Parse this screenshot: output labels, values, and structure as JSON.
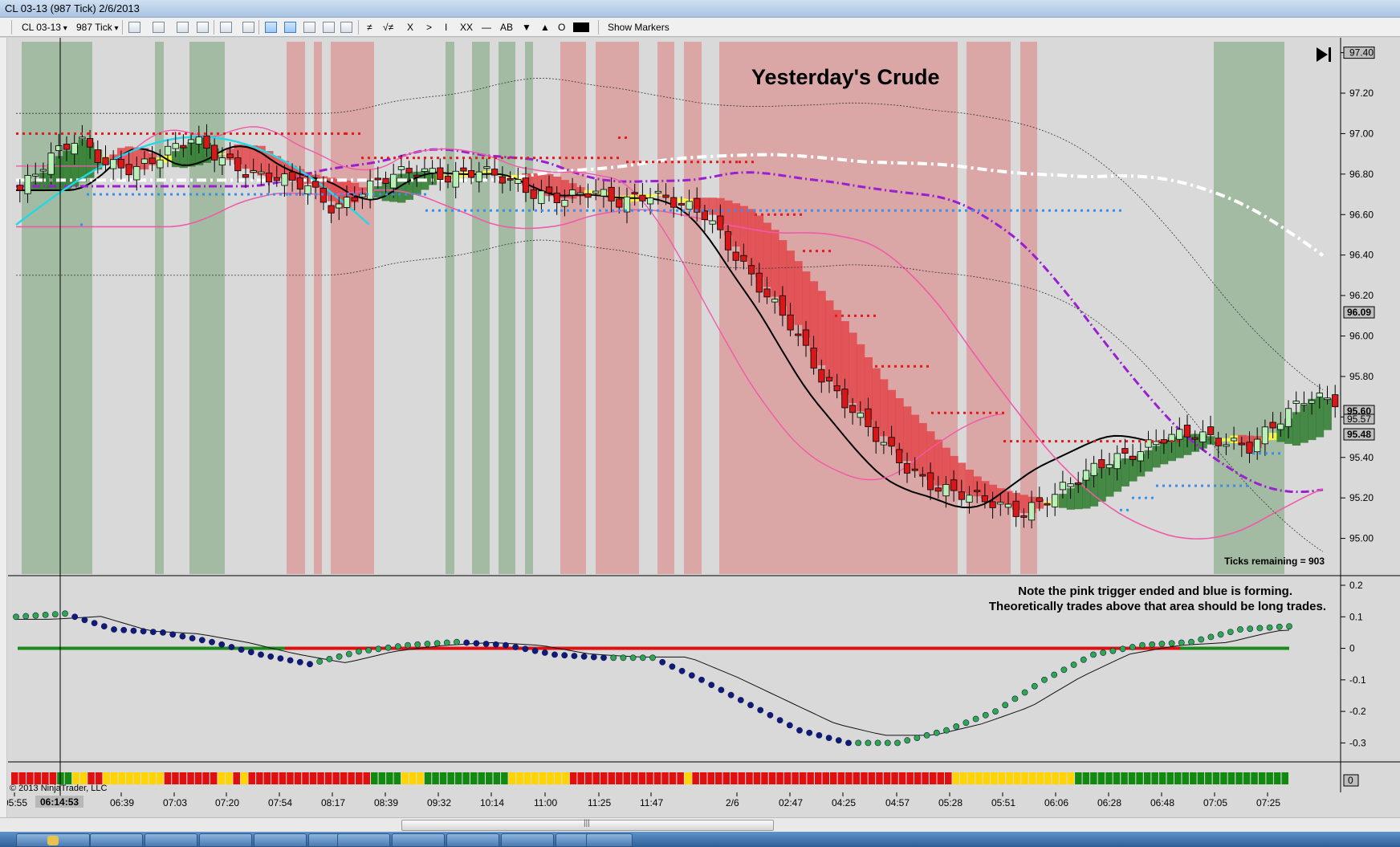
{
  "window": {
    "title": "CL 03-13 (987 Tick)  2/6/2013"
  },
  "toolbar": {
    "instrument": "CL 03-13",
    "interval": "987 Tick",
    "draw_tools": [
      "≠",
      "√≠",
      "X",
      ">",
      "I",
      "XX",
      "—",
      "AB",
      "▼",
      "▲",
      "O"
    ],
    "show_markers": "Show Markers"
  },
  "chart": {
    "annotation_title": "Yesterday's Crude",
    "note_line1": "Note the pink trigger ended and blue is forming.",
    "note_line2": "Theoretically trades above that area should be long trades.",
    "ticks_remaining": "Ticks remaining = 903",
    "copyright": "© 2013 NinjaTrader, LLC",
    "crosshair_time": "06:14:53",
    "price_labels": [
      "97.40",
      "97.20",
      "97.00",
      "96.80",
      "96.60",
      "96.40",
      "96.20",
      "96.00",
      "95.80",
      "95.60",
      "95.40",
      "95.20",
      "95.00"
    ],
    "price_markers": {
      "white_ma": "96.09",
      "last_a": "95.60",
      "last_b": "95.57",
      "blue_trigger": "95.48",
      "osc_bar": "0"
    },
    "osc_labels": [
      "0.2",
      "0.1",
      "0",
      "-0.1",
      "-0.2",
      "-0.3"
    ],
    "time_labels": [
      "05:55",
      "06:39",
      "07:03",
      "07:20",
      "07:54",
      "08:17",
      "08:39",
      "09:32",
      "10:14",
      "11:00",
      "11:25",
      "11:47",
      "2/6",
      "02:47",
      "04:25",
      "04:57",
      "05:28",
      "05:51",
      "06:06",
      "06:28",
      "06:48",
      "07:05",
      "07:25"
    ],
    "colors": {
      "bg": "#d9d9d9",
      "band_green": "#a3baa3",
      "band_red": "#dba6a6",
      "up_candle": "#b9f0b9",
      "down_candle": "#d81818",
      "ribbon_yellow": "#ffff33",
      "purple_ma": "#9a1fd0",
      "cyan_ma": "#23d7e6",
      "pink_ma": "#f05aa8",
      "blue_trigger": "#3a8fe6",
      "red_trigger": "#e51b1b"
    }
  },
  "chart_data": {
    "type": "candlestick",
    "instrument": "CL 03-13",
    "interval": "987 Tick",
    "ylim": [
      94.8,
      97.45
    ],
    "close_path": [
      [
        0,
        96.72
      ],
      [
        2,
        96.88
      ],
      [
        4,
        96.98
      ],
      [
        6,
        96.85
      ],
      [
        8,
        96.82
      ],
      [
        10,
        96.9
      ],
      [
        12,
        96.98
      ],
      [
        14,
        96.88
      ],
      [
        16,
        96.8
      ],
      [
        18,
        96.78
      ],
      [
        20,
        96.75
      ],
      [
        22,
        96.62
      ],
      [
        24,
        96.72
      ],
      [
        26,
        96.8
      ],
      [
        28,
        96.82
      ],
      [
        30,
        96.78
      ],
      [
        32,
        96.82
      ],
      [
        34,
        96.78
      ],
      [
        36,
        96.7
      ],
      [
        38,
        96.68
      ],
      [
        40,
        96.72
      ],
      [
        42,
        96.66
      ],
      [
        44,
        96.7
      ],
      [
        46,
        96.66
      ],
      [
        48,
        96.6
      ],
      [
        50,
        96.4
      ],
      [
        52,
        96.22
      ],
      [
        54,
        96.05
      ],
      [
        56,
        95.8
      ],
      [
        58,
        95.65
      ],
      [
        60,
        95.5
      ],
      [
        62,
        95.35
      ],
      [
        64,
        95.25
      ],
      [
        66,
        95.22
      ],
      [
        68,
        95.18
      ],
      [
        70,
        95.12
      ],
      [
        72,
        95.2
      ],
      [
        74,
        95.3
      ],
      [
        76,
        95.38
      ],
      [
        78,
        95.42
      ],
      [
        80,
        95.5
      ],
      [
        82,
        95.52
      ],
      [
        84,
        95.48
      ],
      [
        86,
        95.45
      ],
      [
        88,
        95.58
      ],
      [
        90,
        95.7
      ],
      [
        92,
        95.68
      ]
    ],
    "oscillator_path": [
      [
        0,
        0.1
      ],
      [
        3,
        0.11
      ],
      [
        6,
        0.06
      ],
      [
        9,
        0.05
      ],
      [
        12,
        0.02
      ],
      [
        15,
        -0.02
      ],
      [
        18,
        -0.05
      ],
      [
        21,
        -0.01
      ],
      [
        24,
        0.01
      ],
      [
        27,
        0.02
      ],
      [
        30,
        0.01
      ],
      [
        33,
        -0.02
      ],
      [
        36,
        -0.03
      ],
      [
        39,
        -0.03
      ],
      [
        42,
        -0.1
      ],
      [
        45,
        -0.18
      ],
      [
        48,
        -0.26
      ],
      [
        51,
        -0.3
      ],
      [
        54,
        -0.3
      ],
      [
        57,
        -0.26
      ],
      [
        60,
        -0.2
      ],
      [
        63,
        -0.1
      ],
      [
        66,
        -0.02
      ],
      [
        69,
        0.01
      ],
      [
        72,
        0.02
      ],
      [
        75,
        0.06
      ],
      [
        78,
        0.07
      ]
    ],
    "osc_ylim": [
      -0.35,
      0.2
    ]
  }
}
